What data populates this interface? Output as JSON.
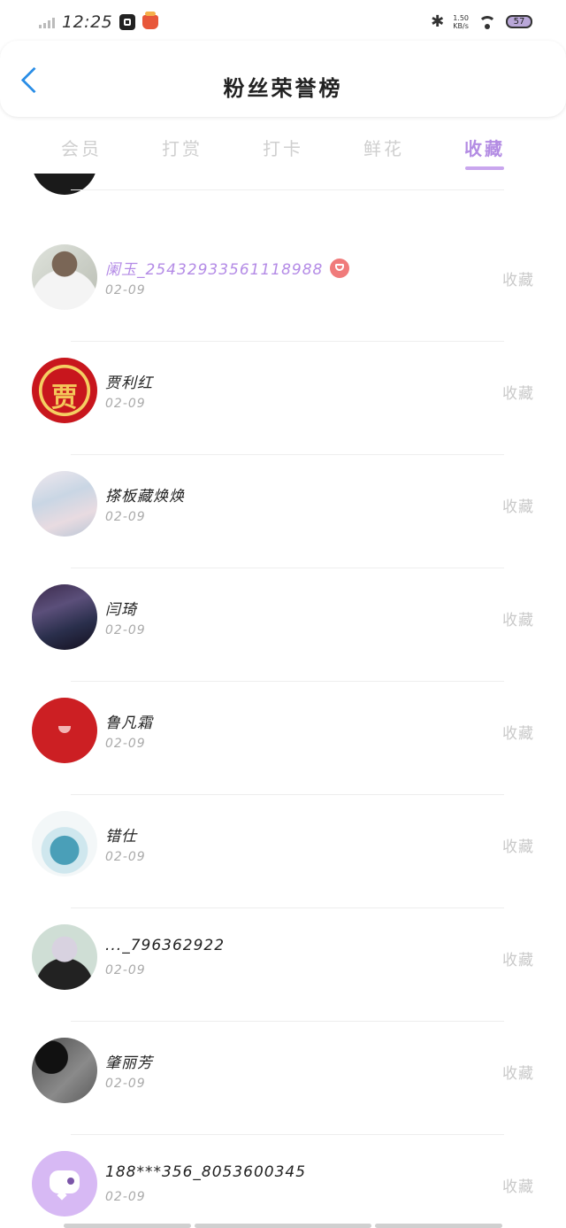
{
  "status_bar": {
    "time": "12:25",
    "net_speed_value": "1.50",
    "net_speed_unit": "KB/s",
    "battery": "57"
  },
  "header": {
    "title": "粉丝荣誉榜"
  },
  "tabs": [
    {
      "label": "会员"
    },
    {
      "label": "打赏"
    },
    {
      "label": "打卡"
    },
    {
      "label": "鲜花"
    },
    {
      "label": "收藏",
      "active": true
    }
  ],
  "list": [
    {
      "name": "阑玉_25432933561118988",
      "date": "02-09",
      "action": "收藏",
      "vip": true
    },
    {
      "name": "贾利红",
      "date": "02-09",
      "action": "收藏",
      "avatar_text": "贾"
    },
    {
      "name": "搽板藏焕焕",
      "date": "02-09",
      "action": "收藏"
    },
    {
      "name": "闫琦",
      "date": "02-09",
      "action": "收藏"
    },
    {
      "name": "鲁凡霜",
      "date": "02-09",
      "action": "收藏"
    },
    {
      "name": "错仕",
      "date": "02-09",
      "action": "收藏"
    },
    {
      "name": "..._796362922",
      "date": "02-09",
      "action": "收藏"
    },
    {
      "name": "肇丽芳",
      "date": "02-09",
      "action": "收藏"
    },
    {
      "name": "188***356_8053600345",
      "date": "02-09",
      "action": "收藏"
    }
  ],
  "colors": {
    "accent": "#b38ce3",
    "back_arrow": "#2b8ee6",
    "vip_badge": "#f07b7b"
  }
}
